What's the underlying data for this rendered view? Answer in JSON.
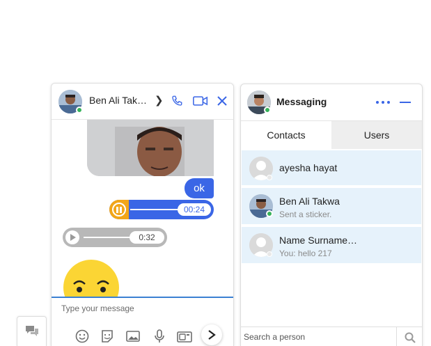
{
  "chat": {
    "contact_name": "Ben Ali Tak…",
    "chevron": "❯",
    "messages": {
      "text_out": "ok",
      "audio_out_time": "00:24",
      "audio_in_time": "0:32"
    },
    "composer_placeholder": "Type your message",
    "icons": [
      "emoji-icon",
      "sticker-icon",
      "image-icon",
      "microphone-icon",
      "camera-icon",
      "send-icon"
    ]
  },
  "messaging": {
    "title": "Messaging",
    "tabs": [
      {
        "label": "Contacts",
        "active": true
      },
      {
        "label": "Users",
        "active": false
      }
    ],
    "contacts": [
      {
        "name": "ayesha hayat",
        "subtitle": "",
        "online": false
      },
      {
        "name": "Ben Ali Takwa",
        "subtitle": "Sent a sticker.",
        "online": true
      },
      {
        "name": "Name Surname…",
        "subtitle": "You: hello 217",
        "online": false
      }
    ],
    "search_placeholder": "Search a person"
  },
  "colors": {
    "accent": "#3a66e6",
    "audio_played": "#f2a619",
    "online": "#36b25a",
    "contact_bg": "#e6f2fb"
  }
}
